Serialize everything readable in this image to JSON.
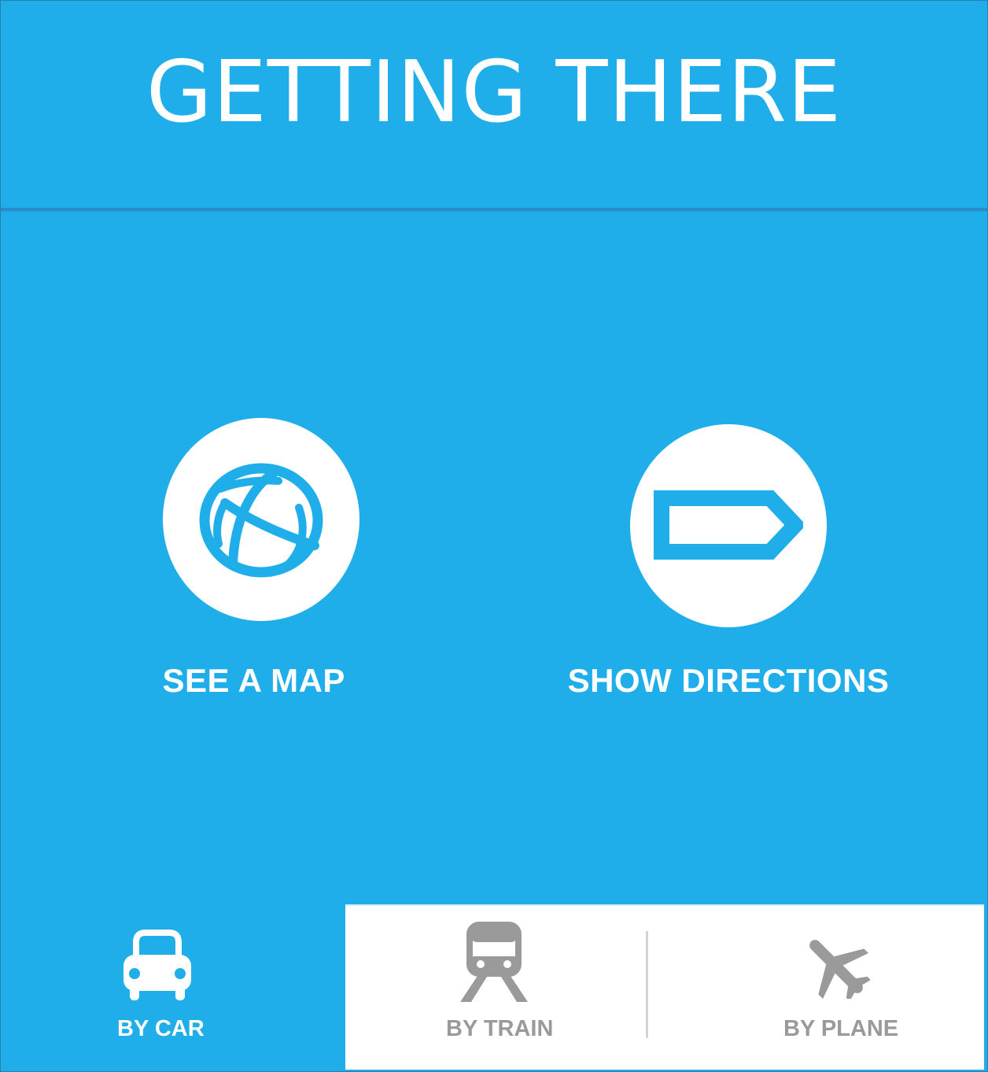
{
  "header": {
    "title": "GETTING THERE"
  },
  "actions": {
    "map": {
      "label": "SEE A MAP",
      "icon": "globe-icon"
    },
    "directions": {
      "label": "SHOW DIRECTIONS",
      "icon": "signpost-arrow-icon"
    }
  },
  "tabs": [
    {
      "label": "BY CAR",
      "icon": "car-icon",
      "selected": true
    },
    {
      "label": "BY TRAIN",
      "icon": "train-icon",
      "selected": false
    },
    {
      "label": "BY PLANE",
      "icon": "plane-icon",
      "selected": false
    }
  ],
  "colors": {
    "background": "#1faee9",
    "divider": "#2a8cc8",
    "white": "#ffffff",
    "inactive_tab": "#9a9a9a",
    "separator": "#d3d3d3"
  }
}
